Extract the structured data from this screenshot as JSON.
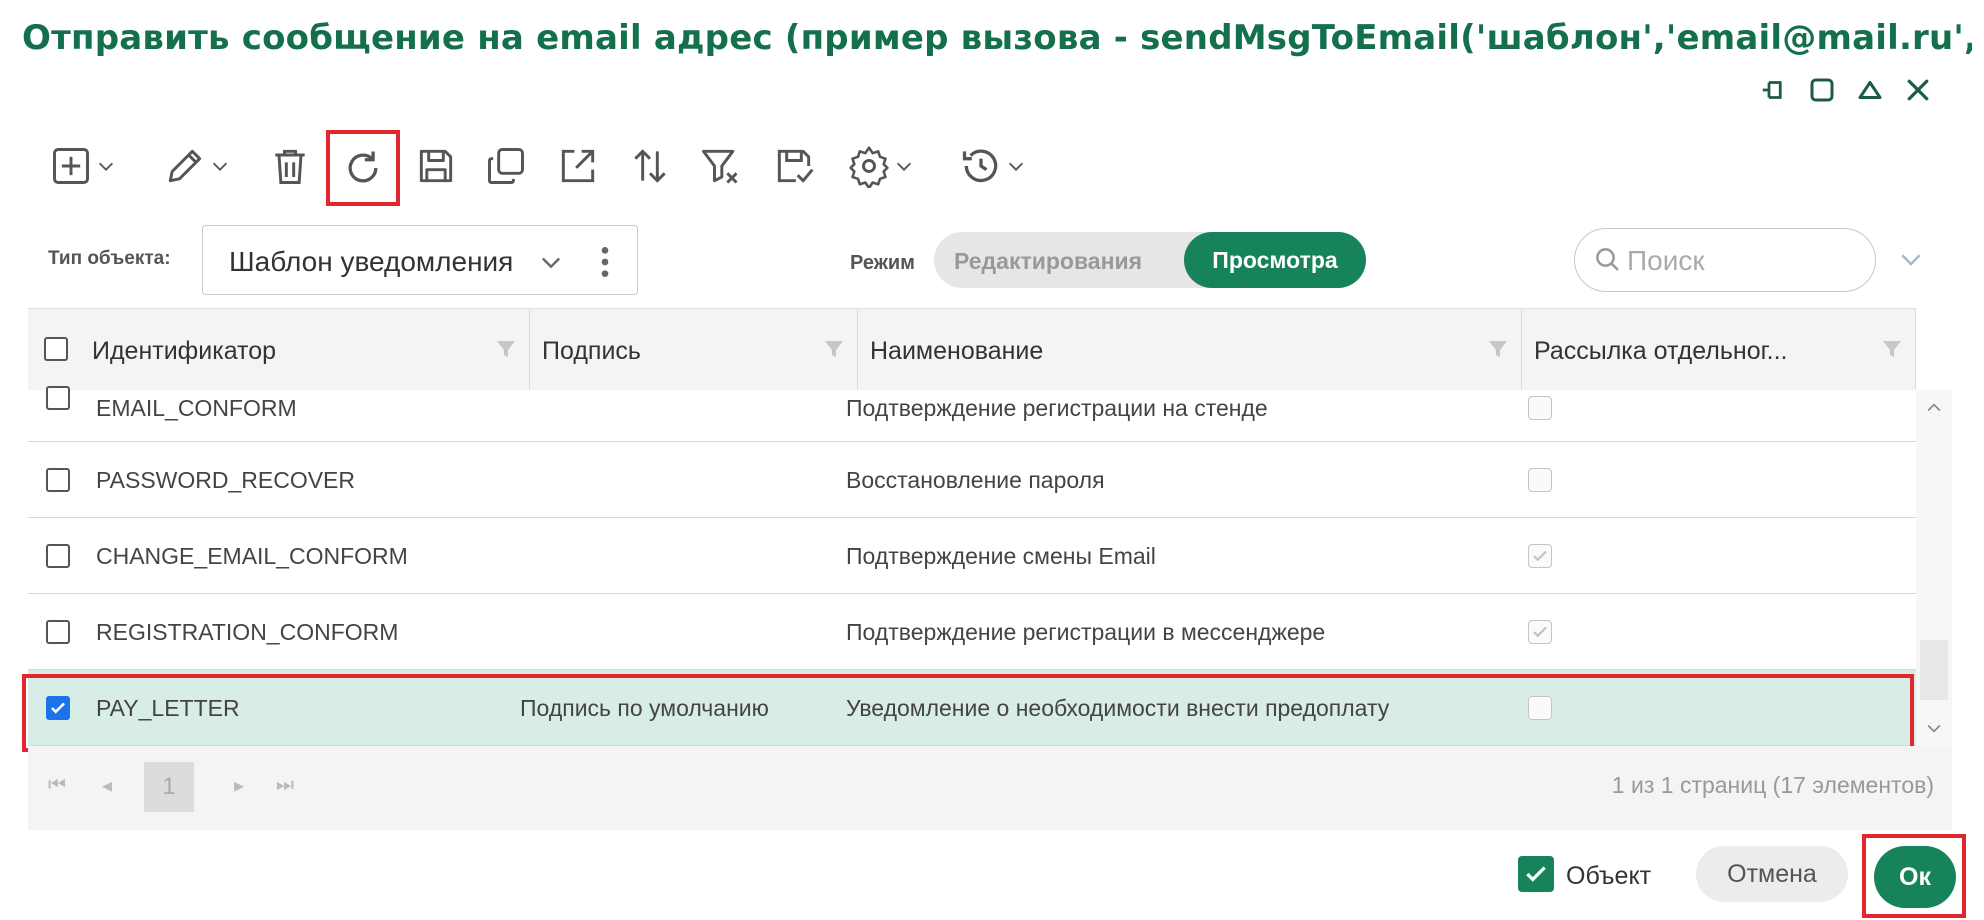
{
  "window": {
    "title": "Отправить сообщение на email адрес (пример вызова - sendMsgToEmail('шаблон','email@mail.ru','c..",
    "controls": [
      "pin-icon",
      "maximize-icon",
      "collapse-icon",
      "close-icon"
    ]
  },
  "toolbar": {
    "buttons": [
      {
        "icon": "add-icon",
        "dropdown": true
      },
      {
        "icon": "edit-icon",
        "dropdown": true
      },
      {
        "icon": "delete-icon",
        "dropdown": false
      },
      {
        "icon": "refresh-icon",
        "dropdown": false,
        "highlighted": true
      },
      {
        "icon": "save-icon",
        "dropdown": false
      },
      {
        "icon": "copy-icon",
        "dropdown": false
      },
      {
        "icon": "open-external-icon",
        "dropdown": false
      },
      {
        "icon": "sort-icon",
        "dropdown": false
      },
      {
        "icon": "clear-filter-icon",
        "dropdown": false
      },
      {
        "icon": "save-check-icon",
        "dropdown": false
      },
      {
        "icon": "settings-icon",
        "dropdown": true
      },
      {
        "icon": "history-icon",
        "dropdown": true
      }
    ]
  },
  "filters": {
    "object_type_label": "Тип объекта:",
    "object_type_value": "Шаблон уведомления",
    "mode_label": "Режим",
    "mode_edit": "Редактирования",
    "mode_view": "Просмотра",
    "search_placeholder": "Поиск"
  },
  "grid": {
    "columns": [
      "Идентификатор",
      "Подпись",
      "Наименование",
      "Рассылка отдельног..."
    ],
    "rows": [
      {
        "id": "EMAIL_CONFORM",
        "signature": "",
        "name": "Подтверждение регистрации на стенде",
        "separate": false,
        "selected": false
      },
      {
        "id": "PASSWORD_RECOVER",
        "signature": "",
        "name": "Восстановление пароля",
        "separate": false,
        "selected": false
      },
      {
        "id": "CHANGE_EMAIL_CONFORM",
        "signature": "",
        "name": "Подтверждение смены Email",
        "separate": true,
        "selected": false
      },
      {
        "id": "REGISTRATION_CONFORM",
        "signature": "",
        "name": "Подтверждение регистрации в мессенджере",
        "separate": true,
        "selected": false
      },
      {
        "id": "PAY_LETTER",
        "signature": "Подпись по умолчанию",
        "name": "Уведомление о необходимости внести предоплату",
        "separate": false,
        "selected": true
      }
    ],
    "pager": {
      "current_page": "1",
      "info": "1 из 1 страниц (17 элементов)"
    }
  },
  "footer": {
    "object_checkbox_label": "Объект",
    "object_checked": true,
    "cancel_label": "Отмена",
    "ok_label": "Ок"
  },
  "colors": {
    "title": "#14704c",
    "accent": "#16835a",
    "highlight_box": "#e0262f",
    "selected_row": "#d8ede6"
  }
}
